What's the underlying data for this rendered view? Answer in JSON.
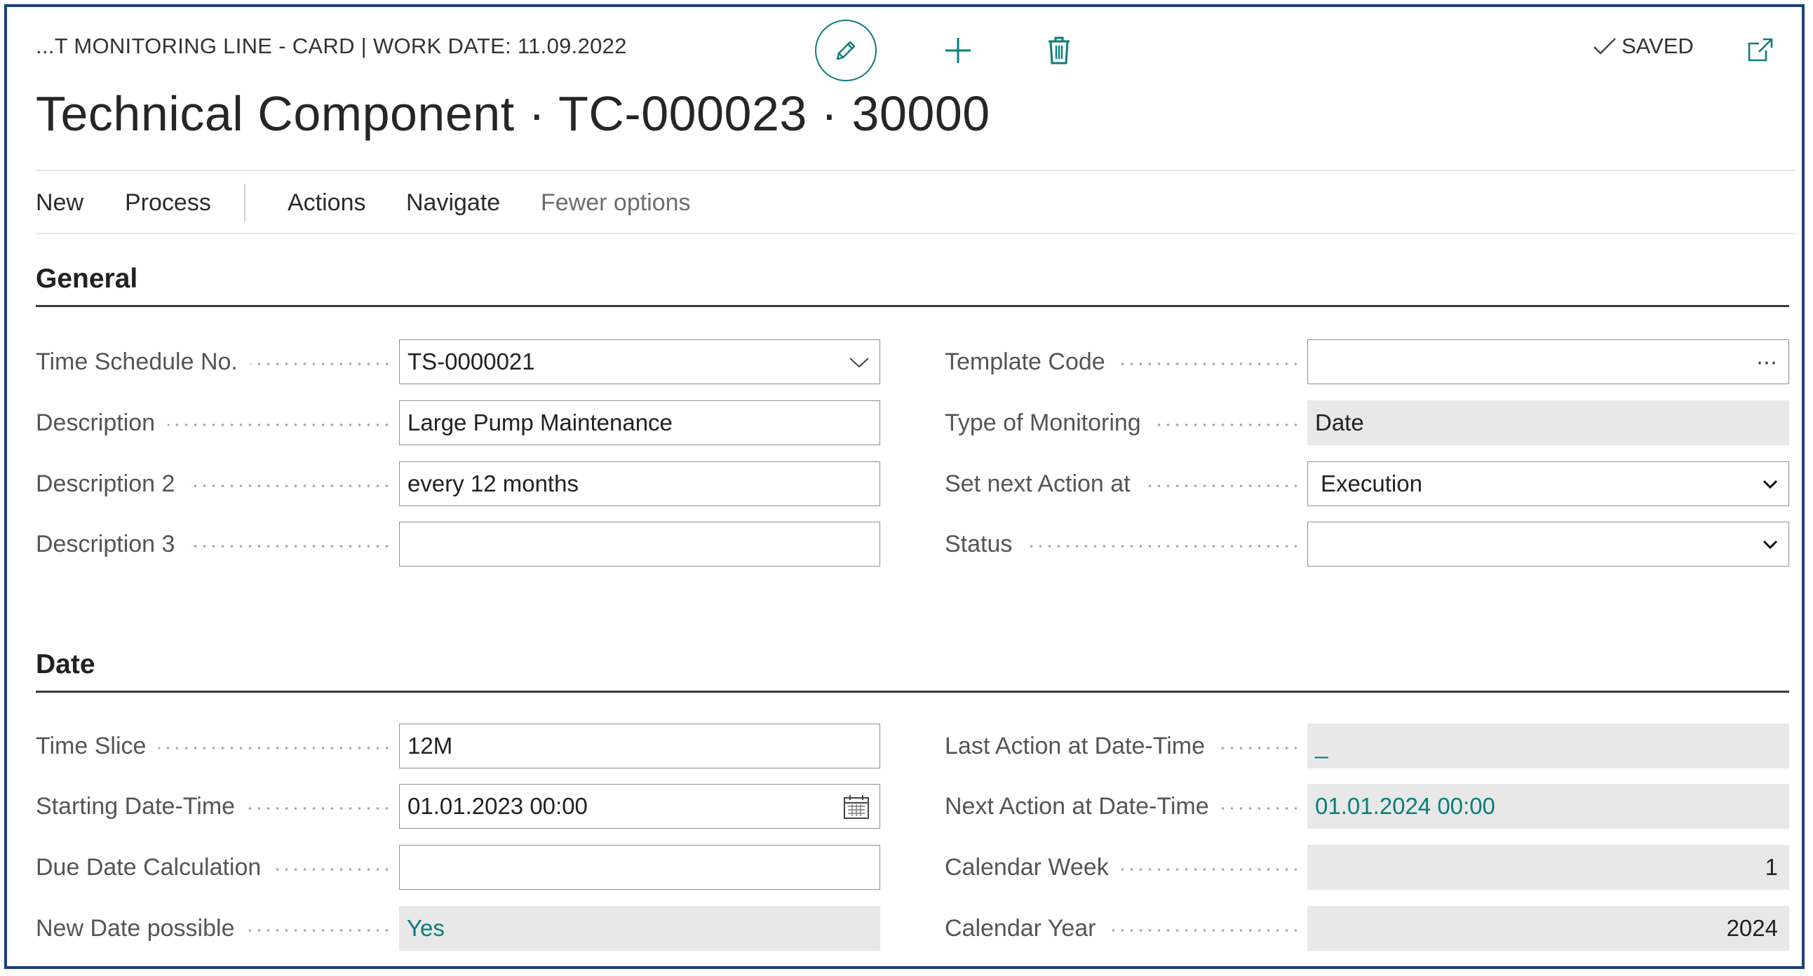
{
  "header": {
    "breadcrumb": "...T MONITORING LINE - CARD | WORK DATE: 11.09.2022",
    "saved_label": "SAVED",
    "title": "Technical Component · TC-000023 · 30000"
  },
  "icons": {
    "edit": "pencil-icon",
    "new": "plus-icon",
    "delete": "trash-icon",
    "saved": "checkmark-icon",
    "popout": "open-in-new-window-icon",
    "dropdown": "chevron-down-icon",
    "lookup": "ellipsis-icon",
    "date": "calendar-icon"
  },
  "menu": {
    "new": "New",
    "process": "Process",
    "actions": "Actions",
    "navigate": "Navigate",
    "fewer": "Fewer options"
  },
  "general": {
    "title": "General",
    "time_schedule_no": {
      "label": "Time Schedule No.",
      "value": "TS-0000021"
    },
    "description": {
      "label": "Description",
      "value": "Large Pump Maintenance"
    },
    "description2": {
      "label": "Description 2",
      "value": "every 12 months"
    },
    "description3": {
      "label": "Description 3",
      "value": ""
    },
    "template_code": {
      "label": "Template Code",
      "value": ""
    },
    "type_of_monitoring": {
      "label": "Type of Monitoring",
      "value": "Date"
    },
    "set_next_action_at": {
      "label": "Set next Action at",
      "value": "Execution"
    },
    "status": {
      "label": "Status",
      "value": ""
    }
  },
  "date": {
    "title": "Date",
    "time_slice": {
      "label": "Time Slice",
      "value": "12M"
    },
    "starting_date_time": {
      "label": "Starting Date-Time",
      "value": "01.01.2023 00:00"
    },
    "due_date_calculation": {
      "label": "Due Date Calculation",
      "value": ""
    },
    "new_date_possible": {
      "label": "New Date possible",
      "value": "Yes"
    },
    "last_action_at": {
      "label": "Last Action at Date-Time",
      "value": "_"
    },
    "next_action_at": {
      "label": "Next Action at Date-Time",
      "value": "01.01.2024 00:00"
    },
    "calendar_week": {
      "label": "Calendar Week",
      "value": "1"
    },
    "calendar_year": {
      "label": "Calendar Year",
      "value": "2024"
    }
  },
  "colors": {
    "accent": "#0a7d7a",
    "frame_border": "#1c3f7a",
    "readonly_bg": "#e8e8e8"
  }
}
